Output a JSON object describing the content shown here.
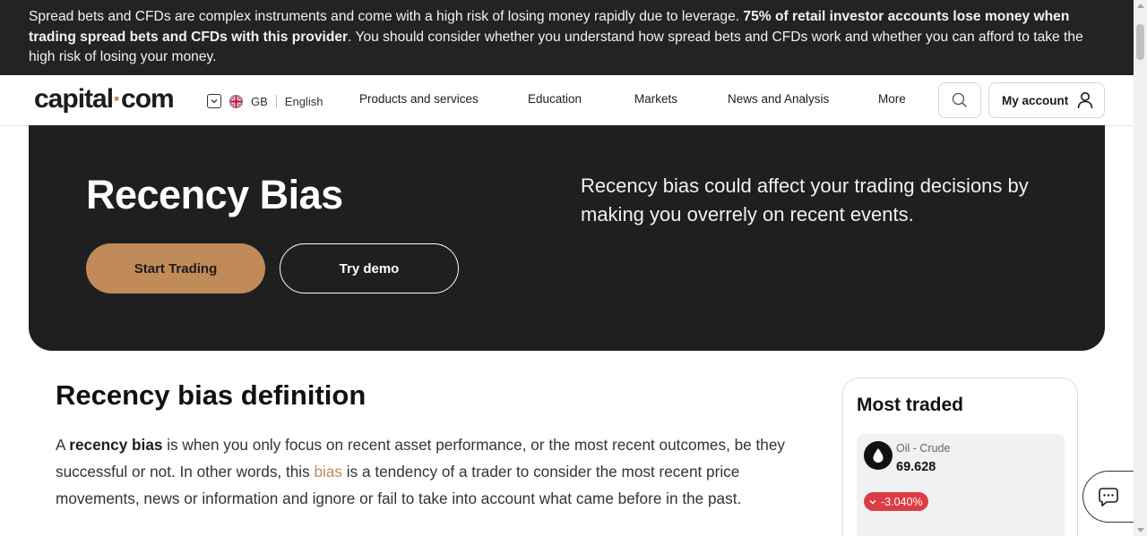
{
  "risk_banner": {
    "text_start": "Spread bets and CFDs are complex instruments and come with a high risk of losing money rapidly due to leverage. ",
    "text_bold": "75% of retail investor accounts lose money when trading spread bets and CFDs with this provider",
    "text_end": ". You should consider whether you understand how spread bets and CFDs work and whether you can afford to take the high risk of losing your money."
  },
  "header": {
    "logo_left": "capital",
    "logo_dot": "·",
    "logo_right": "com",
    "region": "GB",
    "language": "English",
    "nav": [
      "Products and services",
      "Education",
      "Markets",
      "News and Analysis",
      "More"
    ],
    "account_label": "My account"
  },
  "hero": {
    "title": "Recency Bias",
    "start_label": "Start Trading",
    "demo_label": "Try demo",
    "description": "Recency bias could affect your trading decisions by making you overrely on recent events."
  },
  "article": {
    "title": "Recency bias definition",
    "p1_a": "A ",
    "p1_bold": "recency bias",
    "p1_b": " is when you only focus on recent asset performance, or the most recent outcomes, be they successful or not. In other words, this ",
    "p1_link": "bias",
    "p1_c": " is a tendency of a trader to consider the most recent price movements, news or information and ignore or fail to take into account what came before in the past."
  },
  "most_traded": {
    "title": "Most traded",
    "items": [
      {
        "name": "Oil - Crude",
        "price": "69.628",
        "change": "-3.040%",
        "icon": "oil-drop-icon"
      }
    ]
  },
  "colors": {
    "accent": "#c08a59",
    "dark": "#1f1f1f",
    "negative": "#dc3d43"
  }
}
